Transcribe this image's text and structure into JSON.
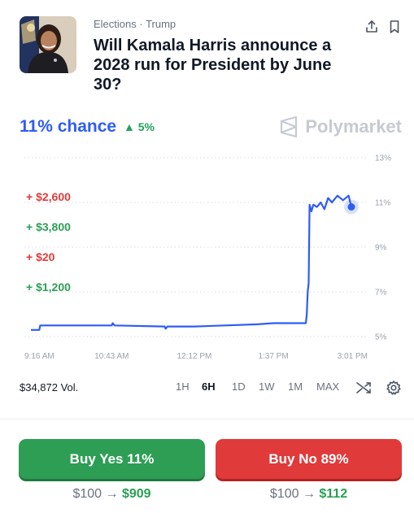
{
  "header": {
    "category": "Elections · Trump",
    "title": "Will Kamala Harris announce a 2028 run for President by June 30?"
  },
  "summary": {
    "chance": "11% chance",
    "delta": "5%",
    "brand": "Polymarket"
  },
  "recent_trades": [
    {
      "label": "+ $2,600",
      "side": "no"
    },
    {
      "label": "+ $3,800",
      "side": "yes"
    },
    {
      "label": "+ $20",
      "side": "no"
    },
    {
      "label": "+ $1,200",
      "side": "yes"
    }
  ],
  "chart_data": {
    "type": "line",
    "y_ticks": [
      "13%",
      "11%",
      "9%",
      "7%",
      "5%"
    ],
    "x_ticks": [
      "9:16 AM",
      "10:43 AM",
      "12:12 PM",
      "1:37 PM",
      "3:01 PM"
    ],
    "ylim": [
      5,
      13
    ],
    "series": [
      {
        "points": [
          [
            "9:16 AM",
            5.3
          ],
          [
            "9:25 AM",
            5.3
          ],
          [
            "9:26 AM",
            5.5
          ],
          [
            "10:43 AM",
            5.5
          ],
          [
            "10:44 AM",
            5.6
          ],
          [
            "10:46 AM",
            5.5
          ],
          [
            "11:40 AM",
            5.45
          ],
          [
            "11:41 AM",
            5.35
          ],
          [
            "11:43 AM",
            5.45
          ],
          [
            "12:12 PM",
            5.45
          ],
          [
            "12:45 PM",
            5.5
          ],
          [
            "1:20 PM",
            5.55
          ],
          [
            "1:37 PM",
            5.6
          ],
          [
            "2:00 PM",
            5.6
          ],
          [
            "2:12 PM",
            5.6
          ],
          [
            "2:13 PM",
            6.0
          ],
          [
            "2:14 PM",
            7.0
          ],
          [
            "2:15 PM",
            7.4
          ],
          [
            "2:16 PM",
            10.9
          ],
          [
            "2:18 PM",
            10.6
          ],
          [
            "2:20 PM",
            10.9
          ],
          [
            "2:24 PM",
            10.8
          ],
          [
            "2:28 PM",
            11.0
          ],
          [
            "2:32 PM",
            10.7
          ],
          [
            "2:36 PM",
            11.2
          ],
          [
            "2:40 PM",
            11.0
          ],
          [
            "2:46 PM",
            11.3
          ],
          [
            "2:52 PM",
            11.1
          ],
          [
            "2:58 PM",
            11.3
          ],
          [
            "3:01 PM",
            10.8
          ]
        ]
      }
    ]
  },
  "controls": {
    "volume": "$34,872 Vol.",
    "ranges": [
      "1H",
      "6H",
      "1D",
      "1W",
      "1M",
      "MAX"
    ],
    "active_range": "6H"
  },
  "buy_yes": {
    "label": "Buy Yes 11%",
    "stake": "$100",
    "arrow": "→",
    "payout": "$909"
  },
  "buy_no": {
    "label": "Buy No 89%",
    "stake": "$100",
    "arrow": "→",
    "payout": "$112"
  },
  "colors": {
    "accent": "#2f5cf6",
    "yes": "#2e9e55",
    "no": "#e13a3a",
    "up": "#21a15a"
  }
}
